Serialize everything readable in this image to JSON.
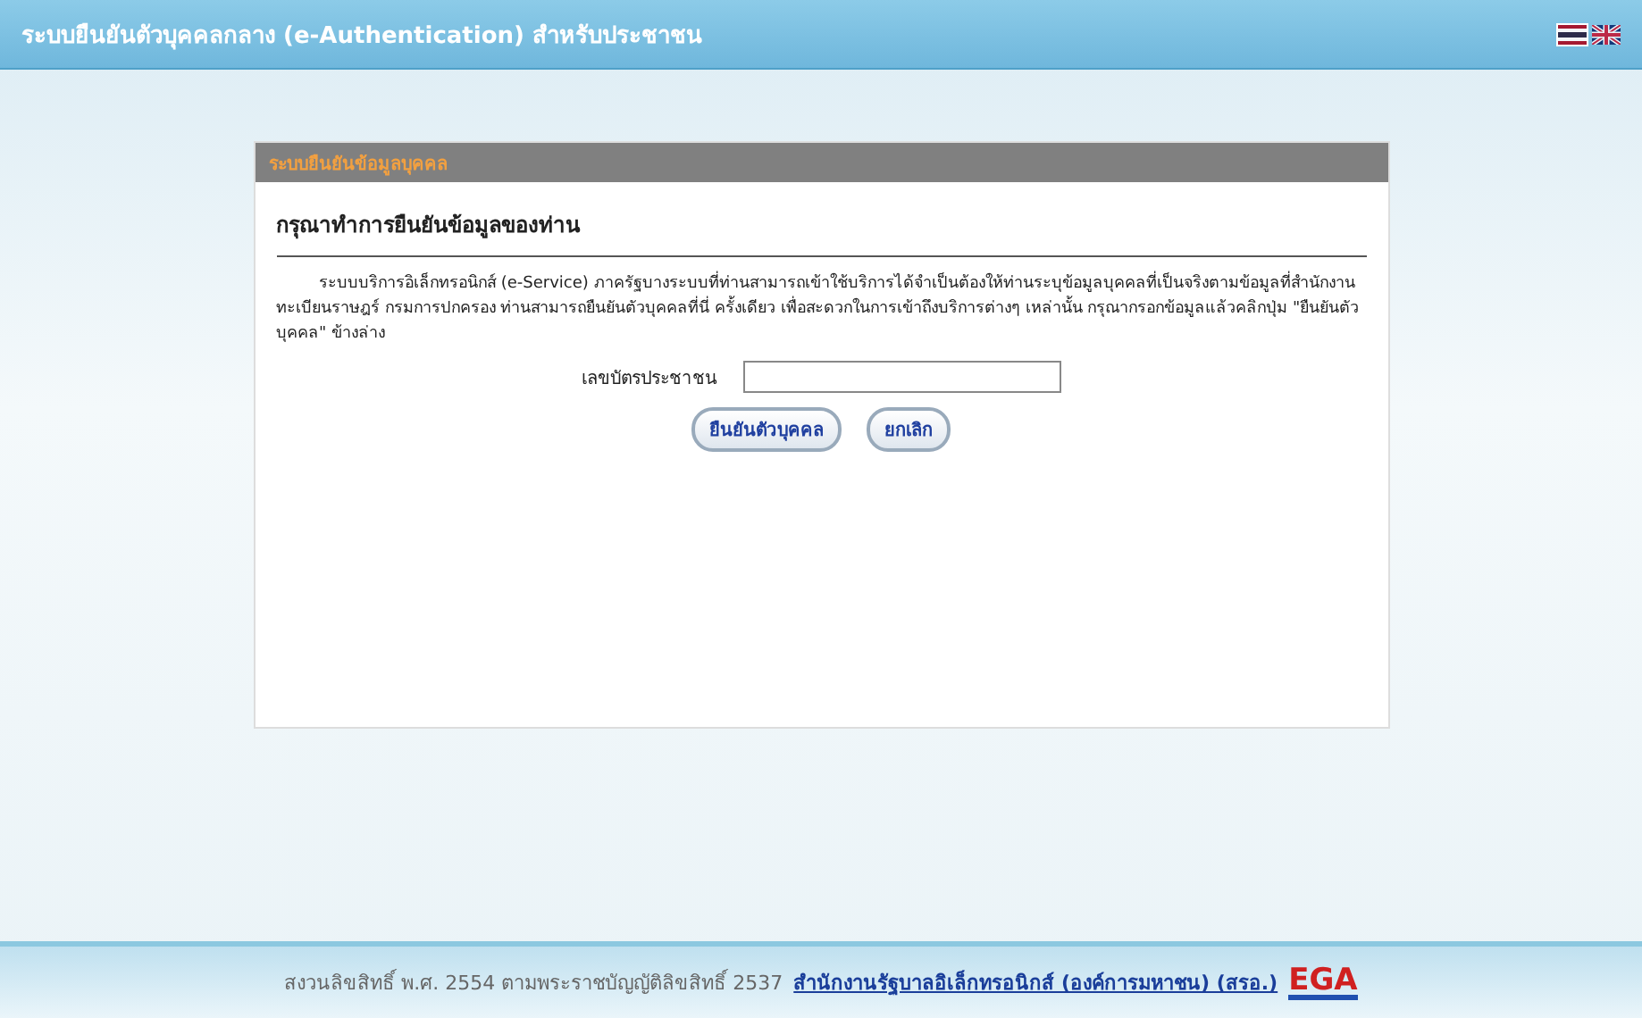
{
  "header": {
    "title": "ระบบยืนยันตัวบุคคลกลาง (e-Authentication) สำหรับประชาชน",
    "languages": [
      {
        "kind": "thai",
        "selected": true
      },
      {
        "kind": "english",
        "selected": false
      }
    ]
  },
  "panel": {
    "title": "ระบบยืนยันข้อมูลบุคคล",
    "heading": "กรุณาทำการยืนยันข้อมูลของท่าน",
    "description": "ระบบบริการอิเล็กทรอนิกส์ (e-Service) ภาครัฐบางระบบที่ท่านสามารถเข้าใช้บริการได้จำเป็นต้องให้ท่านระบุข้อมูลบุคคลที่เป็นจริงตามข้อมูลที่สำนักงานทะเบียนราษฎร์ กรมการปกครอง ท่านสามารถยืนยันตัวบุคคลที่นี่ ครั้งเดียว เพื่อสะดวกในการเข้าถึงบริการต่างๆ เหล่านั้น กรุณากรอกข้อมูลแล้วคลิกปุ่ม \"ยืนยันตัวบุคคล\" ข้างล่าง",
    "field_label": "เลขบัตรประชาชน",
    "buttons": [
      "ยืนยันตัวบุคคล",
      "ยกเลิก"
    ]
  },
  "footer": {
    "copyright": "สงวนลิขสิทธิ์ พ.ศ. 2554 ตามพระราชบัญญัติลิขสิทธิ์ 2537",
    "link": "สำนักงานรัฐบาลอิเล็กทรอนิกส์ (องค์การมหาชน) (สรอ.)",
    "logo": "EGA"
  }
}
